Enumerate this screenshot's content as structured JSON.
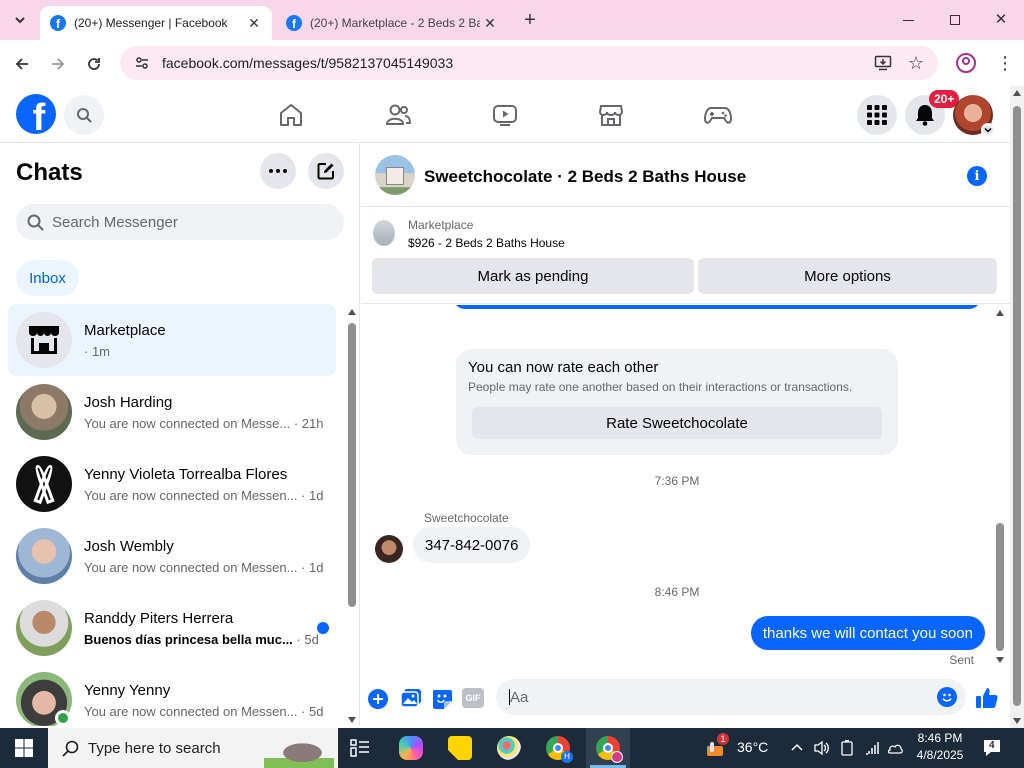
{
  "browser": {
    "tabs": [
      {
        "title": "(20+) Messenger | Facebook",
        "active": true
      },
      {
        "title": "(20+) Marketplace - 2 Beds 2 Ba",
        "active": false
      }
    ],
    "url": "facebook.com/messages/t/9582137045149033"
  },
  "fb": {
    "notif_badge": "20+"
  },
  "chats": {
    "title": "Chats",
    "search_placeholder": "Search Messenger",
    "filter": "Inbox",
    "items": [
      {
        "name": "Marketplace",
        "sub": "· 1m",
        "time": "",
        "unread": false,
        "active": true
      },
      {
        "name": "Josh Harding",
        "sub": "You are now connected on Messe...",
        "time": "· 21h",
        "unread": false,
        "active": false
      },
      {
        "name": "Yenny Violeta Torrealba Flores",
        "sub": "You are now connected on Messen...",
        "time": "· 1d",
        "unread": false,
        "active": false
      },
      {
        "name": "Josh Wembly",
        "sub": "You are now connected on Messen...",
        "time": "· 1d",
        "unread": false,
        "active": false
      },
      {
        "name": "Randdy Piters Herrera",
        "sub": "Buenos días princesa bella muc...",
        "time": "· 5d",
        "unread": true,
        "active": false
      },
      {
        "name": "Yenny Yenny",
        "sub": "You are now connected on Messen...",
        "time": "· 5d",
        "unread": false,
        "active": false
      }
    ]
  },
  "conversation": {
    "title": "Sweetchocolate · 2 Beds 2 Baths House",
    "listing_source": "Marketplace",
    "listing_title": "$926 - 2 Beds 2 Baths House",
    "mark_pending_label": "Mark as pending",
    "more_options_label": "More options",
    "rate_card": {
      "title": "You can now rate each other",
      "body": "People may rate one another based on their interactions or transactions.",
      "button": "Rate Sweetchocolate"
    },
    "timestamp1": "7:36 PM",
    "sender_name": "Sweetchocolate",
    "incoming_message": "347-842-0076",
    "timestamp2": "8:46 PM",
    "outgoing_message": "thanks we will contact you soon",
    "outgoing_status": "Sent",
    "composer_placeholder": "Aa",
    "gif_label": "GIF"
  },
  "taskbar": {
    "search_placeholder": "Type here to search",
    "weather": "36°C",
    "time": "8:46 PM",
    "date": "4/8/2025",
    "notification_count": "4",
    "weather_badge": "1"
  },
  "colors": {
    "fb_blue": "#0866ff",
    "tab_bar": "#f8d7ea",
    "taskbar": "#1c2a3a"
  }
}
